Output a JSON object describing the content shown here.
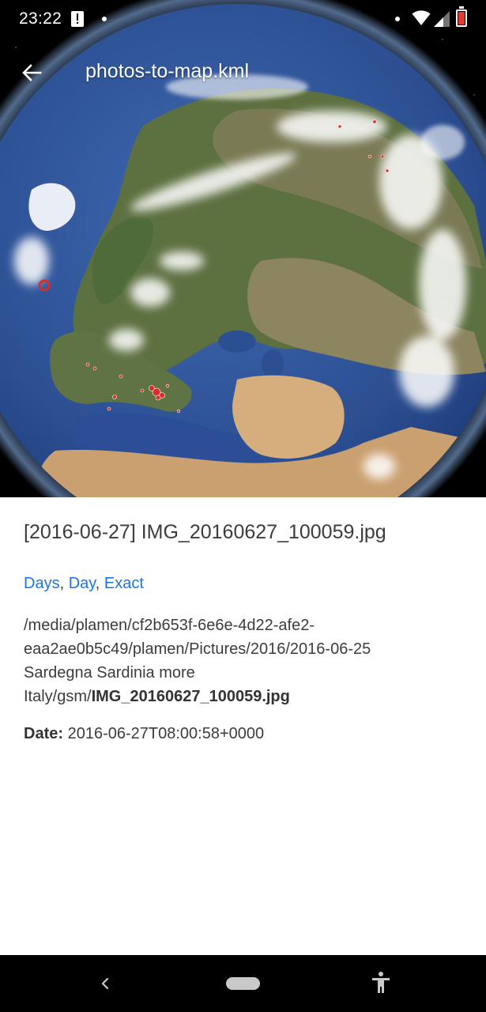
{
  "status_bar": {
    "time": "23:22",
    "icons": [
      "alert-icon",
      "notification-dot-icon",
      "notification-dot-icon",
      "wifi-icon",
      "signal-icon",
      "battery-icon"
    ],
    "battery_color": "#e53935"
  },
  "app_bar": {
    "title": "photos-to-map.kml",
    "back_icon": "arrow-back-icon"
  },
  "map": {
    "view": "earth-globe-satellite",
    "marker_color": "#d32f2f"
  },
  "item": {
    "title": "[2016-06-27] IMG_20160627_100059.jpg",
    "tags": [
      "Days",
      "Day",
      "Exact"
    ],
    "tag_separator": ", ",
    "path_lines": [
      "/media/plamen/cf2b653f-6e6e-4d22-afe2-",
      "eaa2ae0b5c49/plamen/Pictures/2016/2016-06-25",
      "Sardegna Sardinia more"
    ],
    "path_prefix_last": "Italy/gsm/",
    "filename": "IMG_20160627_100059.jpg",
    "date_label": "Date:",
    "date_value": "2016-06-27T08:00:58+0000"
  },
  "colors": {
    "link": "#1a73e8",
    "text": "#3c3c3c",
    "nav_bar": "#000000"
  },
  "nav_bar": {
    "icons": [
      "nav-back-icon",
      "home-pill-icon",
      "accessibility-icon"
    ]
  }
}
